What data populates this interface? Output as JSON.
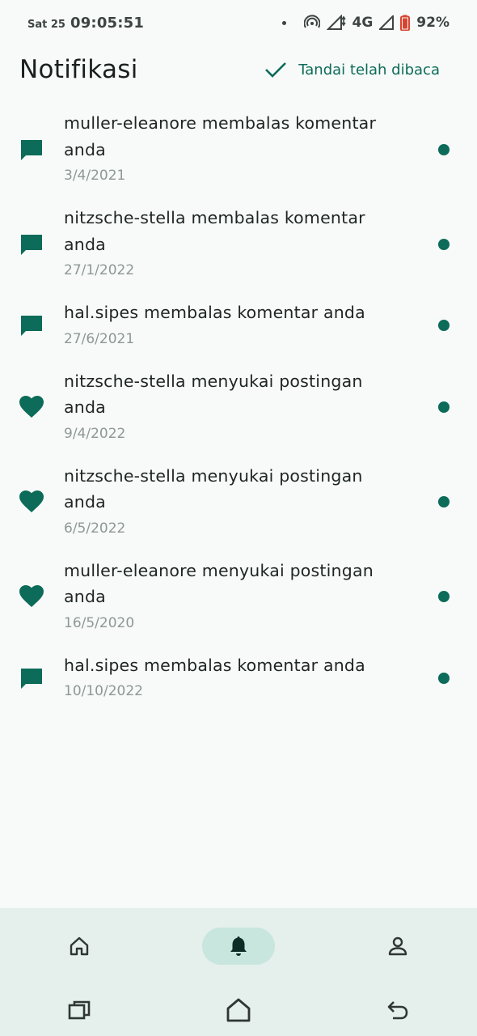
{
  "status_bar": {
    "day": "Sat 25",
    "time": "09:05:51",
    "network": "4G",
    "battery": "92%"
  },
  "header": {
    "title": "Notifikasi",
    "mark_read_label": "Tandai telah dibaca",
    "mark_read_icon": "check-icon"
  },
  "colors": {
    "accent": "#0c6b59",
    "nav_background": "#e5efec",
    "nav_active_pill": "#c8e6dd",
    "date_text": "#8f9895"
  },
  "notifications": [
    {
      "icon": "comment-icon",
      "text": "muller-eleanore membalas komentar anda",
      "date": "3/4/2021",
      "unread": true
    },
    {
      "icon": "comment-icon",
      "text": "nitzsche-stella membalas komentar anda",
      "date": "27/1/2022",
      "unread": true
    },
    {
      "icon": "comment-icon",
      "text": "hal.sipes membalas komentar anda",
      "date": "27/6/2021",
      "unread": true
    },
    {
      "icon": "heart-icon",
      "text": "nitzsche-stella menyukai postingan anda",
      "date": "9/4/2022",
      "unread": true
    },
    {
      "icon": "heart-icon",
      "text": "nitzsche-stella menyukai postingan anda",
      "date": "6/5/2022",
      "unread": true
    },
    {
      "icon": "heart-icon",
      "text": "muller-eleanore menyukai postingan anda",
      "date": "16/5/2020",
      "unread": true
    },
    {
      "icon": "comment-icon",
      "text": "hal.sipes membalas komentar anda",
      "date": "10/10/2022",
      "unread": true
    }
  ],
  "bottom_nav": {
    "items": [
      {
        "icon": "home-icon",
        "active": false
      },
      {
        "icon": "bell-icon",
        "active": true
      },
      {
        "icon": "profile-icon",
        "active": false
      }
    ]
  },
  "system_nav": {
    "items": [
      "recents-icon",
      "home-outline-icon",
      "back-icon"
    ]
  }
}
